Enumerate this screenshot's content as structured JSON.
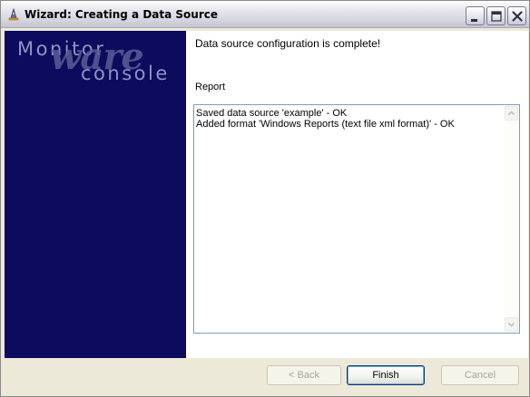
{
  "window": {
    "title": "Wizard: Creating a Data Source"
  },
  "banner": {
    "logo_word_1": "Monitor",
    "logo_word_2": "ware",
    "logo_word_3": "console",
    "background": "#0c0b5e"
  },
  "content": {
    "heading": "Data source configuration is complete!",
    "report_label": "Report",
    "report_lines": [
      "Saved data source 'example' - OK",
      "Added format 'Windows Reports (text file xml format)' - OK"
    ]
  },
  "buttons": {
    "back": "< Back",
    "finish": "Finish",
    "cancel": "Cancel"
  },
  "icons": {
    "title": "wizard-hat-icon",
    "minimize": "minimize-icon",
    "maximize": "maximize-icon",
    "close": "close-icon",
    "scroll_up": "scroll-up-arrow-icon",
    "scroll_down": "scroll-down-arrow-icon"
  }
}
